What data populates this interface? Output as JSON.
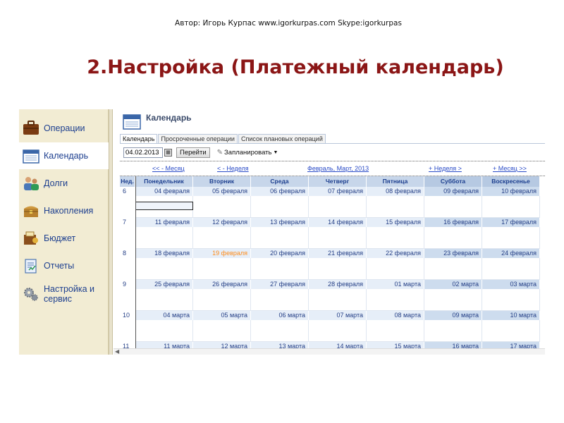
{
  "author": "Автор: Игорь Курпас www.igorkurpas.com  Skype:igorkurpas",
  "slide_title": "2.Настройка (Платежный календарь)",
  "sidebar": {
    "items": [
      {
        "label": "Операции",
        "icon": "briefcase-icon"
      },
      {
        "label": "Календарь",
        "icon": "calendar-icon"
      },
      {
        "label": "Долги",
        "icon": "people-icon"
      },
      {
        "label": "Накопления",
        "icon": "treasure-chest-icon"
      },
      {
        "label": "Бюджет",
        "icon": "budget-icon"
      },
      {
        "label": "Отчеты",
        "icon": "report-icon"
      },
      {
        "label": "Настройка и сервис",
        "icon": "gears-icon"
      }
    ],
    "active_index": 1
  },
  "main": {
    "title": "Календарь",
    "tabs": [
      {
        "label": "Календарь"
      },
      {
        "label": "Просроченные операции"
      },
      {
        "label": "Список плановых операций"
      }
    ],
    "date_value": "04.02.2013",
    "go_label": "Перейти",
    "plan_label": "Запланировать"
  },
  "calendar": {
    "nav": {
      "prev_month": "<< - Месяц",
      "prev_week": "< - Неделя",
      "period": "Февраль, Март, 2013",
      "next_week": "+ Неделя >",
      "next_month": "+ Месяц >>"
    },
    "headers": [
      "Нед.",
      "Понедельник",
      "Вторник",
      "Среда",
      "Четверг",
      "Пятница",
      "Суббота",
      "Воскресенье"
    ],
    "weeks": [
      {
        "week": "6",
        "days": [
          "04 февраля",
          "05 февраля",
          "06 февраля",
          "07 февраля",
          "08 февраля",
          "09 февраля",
          "10 февраля"
        ]
      },
      {
        "week": "7",
        "days": [
          "11 февраля",
          "12 февраля",
          "13 февраля",
          "14 февраля",
          "15 февраля",
          "16 февраля",
          "17 февраля"
        ]
      },
      {
        "week": "8",
        "days": [
          "18 февраля",
          "19 февраля",
          "20 февраля",
          "21 февраля",
          "22 февраля",
          "23 февраля",
          "24 февраля"
        ]
      },
      {
        "week": "9",
        "days": [
          "25 февраля",
          "26 февраля",
          "27 февраля",
          "28 февраля",
          "01 марта",
          "02 марта",
          "03 марта"
        ]
      },
      {
        "week": "10",
        "days": [
          "04 марта",
          "05 марта",
          "06 марта",
          "07 марта",
          "08 марта",
          "09 марта",
          "10 марта"
        ]
      },
      {
        "week": "11",
        "days": [
          "11 марта",
          "12 марта",
          "13 марта",
          "14 марта",
          "15 марта",
          "16 марта",
          "17 марта"
        ]
      }
    ],
    "highlight_day": "19 февраля",
    "colors": {
      "highlight": "#ff8c1a",
      "header_bg": "#c7d6ea",
      "weekend_bg": "#cddcee",
      "link": "#2a4bc7",
      "title": "#8b1616"
    }
  }
}
